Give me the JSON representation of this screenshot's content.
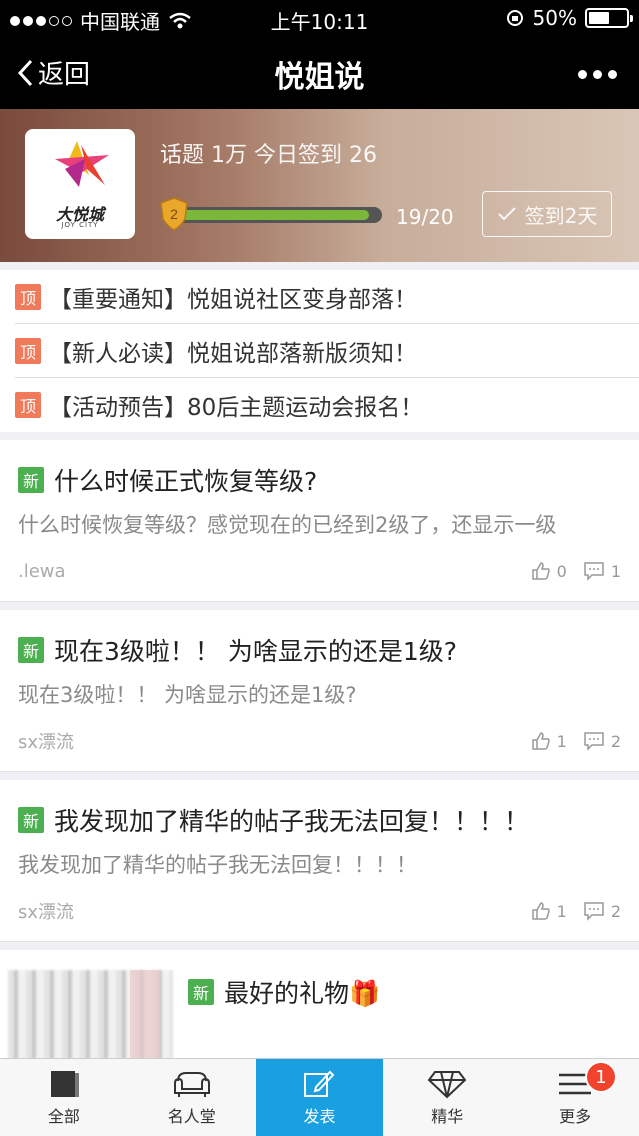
{
  "status_bar": {
    "carrier": "中国联通",
    "time": "上午10:11",
    "battery": "50%"
  },
  "nav": {
    "back_label": "返回",
    "title": "悦姐说"
  },
  "header": {
    "logo_text": "大悦城",
    "logo_sub": "JOY CITY",
    "stats": "话题 1万  今日签到 26",
    "level": "2",
    "progress_text": "19/20",
    "progress_fraction": 0.95,
    "checkin_label": "签到2天"
  },
  "pinned": [
    {
      "badge": "顶",
      "text": "【重要通知】悦姐说社区变身部落！"
    },
    {
      "badge": "顶",
      "text": "【新人必读】悦姐说部落新版须知！"
    },
    {
      "badge": "顶",
      "text": "【活动预告】80后主题运动会报名！"
    }
  ],
  "posts": [
    {
      "badge": "新",
      "title": "什么时候正式恢复等级?",
      "body": "什么时候恢复等级？感觉现在的已经到2级了，还显示一级",
      "author": ".lewa",
      "likes": "0",
      "comments": "1"
    },
    {
      "badge": "新",
      "title": "现在3级啦！！ 为啥显示的还是1级?",
      "body": "现在3级啦！！ 为啥显示的还是1级?",
      "author": "sx漂流",
      "likes": "1",
      "comments": "2"
    },
    {
      "badge": "新",
      "title": "我发现加了精华的帖子我无法回复！！！！",
      "body": "我发现加了精华的帖子我无法回复！！！！",
      "author": "sx漂流",
      "likes": "1",
      "comments": "2"
    }
  ],
  "image_post": {
    "badge": "新",
    "title": "最好的礼物🎁"
  },
  "tabbar": {
    "tabs": [
      {
        "label": "全部"
      },
      {
        "label": "名人堂"
      },
      {
        "label": "发表"
      },
      {
        "label": "精华"
      },
      {
        "label": "更多"
      }
    ],
    "more_badge": "1"
  },
  "colors": {
    "accent": "#1a9fe0",
    "pin_badge": "#f07a5a",
    "new_badge": "#4cb050",
    "badge_red": "#f2432e"
  }
}
